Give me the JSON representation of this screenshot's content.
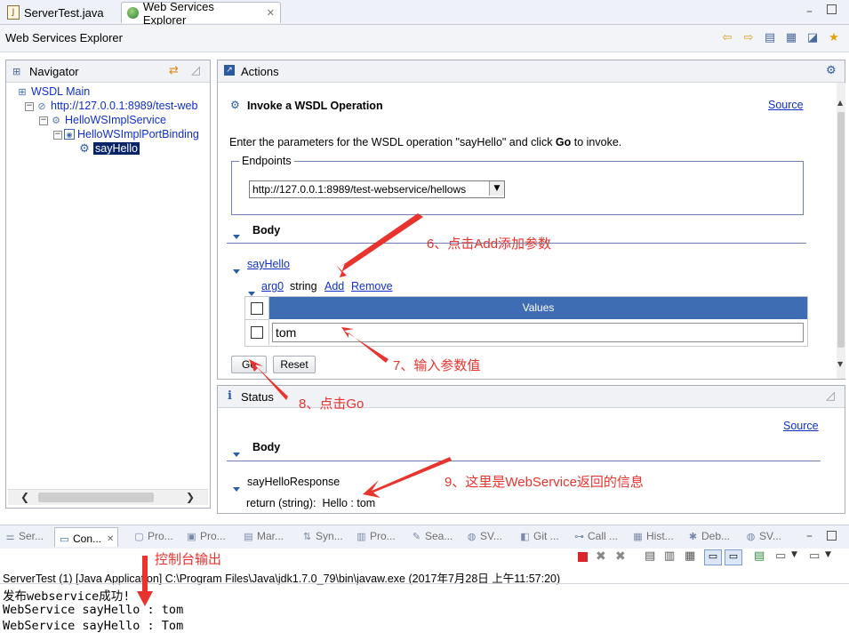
{
  "editor_tabs": [
    {
      "label": "ServerTest.java",
      "icon": "java-file-icon"
    },
    {
      "label": "Web Services Explorer",
      "icon": "globe-icon"
    }
  ],
  "wse_title": "Web Services Explorer",
  "navigator": {
    "title": "Navigator",
    "items": [
      {
        "label": "WSDL Main",
        "icon": "wsdl-main-icon"
      },
      {
        "label": "http://127.0.0.1:8989/test-web",
        "icon": "wsdl-url-icon"
      },
      {
        "label": "HelloWSImplService",
        "icon": "service-icon"
      },
      {
        "label": "HelloWSImplPortBinding",
        "icon": "binding-icon"
      },
      {
        "label": "sayHello",
        "icon": "operation-gear-icon"
      }
    ]
  },
  "actions": {
    "title": "Actions",
    "heading": "Invoke a WSDL Operation",
    "source_link": "Source",
    "instruction_pre": "Enter the parameters for the WSDL operation \"sayHello\" and click ",
    "instruction_bold": "Go",
    "instruction_post": " to invoke.",
    "endpoints_legend": "Endpoints",
    "endpoint_value": "http://127.0.0.1:8989/test-webservice/hellows",
    "body_label": "Body",
    "operation_link": "sayHello",
    "arg_link": "arg0",
    "arg_type": "string",
    "add_link": "Add",
    "remove_link": "Remove",
    "values_header": "Values",
    "value_input": "tom",
    "go_button": "Go",
    "reset_button": "Reset"
  },
  "status": {
    "title": "Status",
    "source_link": "Source",
    "body_label": "Body",
    "response_label": "sayHelloResponse",
    "return_label": "return (string):",
    "return_value": "Hello : tom"
  },
  "annotations": {
    "a6": "6、点击Add添加参数",
    "a7": "7、输入参数值",
    "a8": "8、点击Go",
    "a9": "9、这里是WebService返回的信息",
    "console": "控制台输出"
  },
  "console_tabs": [
    {
      "label": "Ser...",
      "icon": "servers-icon"
    },
    {
      "label": "Con...",
      "icon": "console-icon"
    },
    {
      "label": "Pro...",
      "icon": "problems-icon"
    },
    {
      "label": "Pro...",
      "icon": "progress-icon"
    },
    {
      "label": "Mar...",
      "icon": "markers-icon"
    },
    {
      "label": "Syn...",
      "icon": "synchronize-icon"
    },
    {
      "label": "Pro...",
      "icon": "properties-icon"
    },
    {
      "label": "Sea...",
      "icon": "search-icon"
    },
    {
      "label": "SV...",
      "icon": "svn-icon"
    },
    {
      "label": "Git ...",
      "icon": "git-icon"
    },
    {
      "label": "Call ...",
      "icon": "call-hierarchy-icon"
    },
    {
      "label": "Hist...",
      "icon": "history-icon"
    },
    {
      "label": "Deb...",
      "icon": "debug-icon"
    },
    {
      "label": "SV...",
      "icon": "svn-icon"
    }
  ],
  "console": {
    "launch_info": "ServerTest (1) [Java Application] C:\\Program Files\\Java\\jdk1.7.0_79\\bin\\javaw.exe (2017年7月28日 上午11:57:20)",
    "lines": [
      "发布webservice成功!",
      "WebService sayHello : tom",
      "WebService sayHello : Tom"
    ]
  },
  "colors": {
    "accent_blue": "#3e6db4",
    "link_blue": "#1030c8",
    "annotation_red": "#e8332e"
  }
}
